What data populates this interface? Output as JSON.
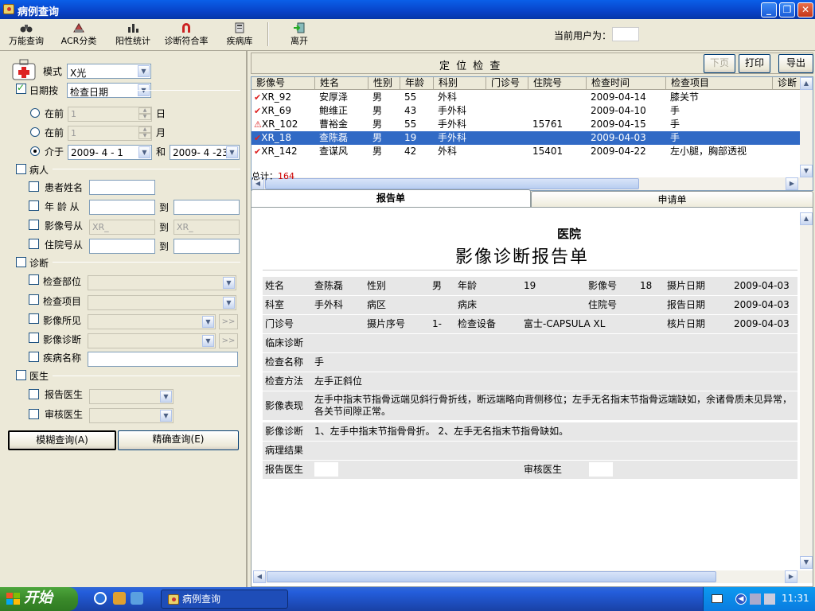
{
  "window": {
    "title": "病例查询"
  },
  "toolbar": {
    "items": [
      {
        "label": "万能查询",
        "icon": "binoculars-icon"
      },
      {
        "label": "ACR分类",
        "icon": "classify-icon"
      },
      {
        "label": "阳性统计",
        "icon": "statistics-icon"
      },
      {
        "label": "诊断符合率",
        "icon": "magnet-icon"
      },
      {
        "label": "疾病库",
        "icon": "disease-library-icon"
      },
      {
        "label": "离开",
        "icon": "exit-icon"
      }
    ],
    "current_user_label": "当前用户为：",
    "current_user_value": ""
  },
  "left": {
    "mode_label": "模式",
    "mode_value": "X光",
    "date_by_label": "日期按",
    "date_by_value": "检查日期",
    "before1_label": "在前",
    "before1_value": "1",
    "before1_unit": "日",
    "before2_label": "在前",
    "before2_value": "1",
    "before2_unit": "月",
    "between_label": "介于",
    "date_from": "2009- 4 - 1",
    "and_label": "和",
    "date_to": "2009- 4 -23",
    "patient_group": "病人",
    "patient_name_label": "患者姓名",
    "age_label": "年 龄 从",
    "to_label": "到",
    "image_no_label": "影像号从",
    "image_prefix": "XR_",
    "inpatient_label": "住院号从",
    "diagnosis_group": "诊断",
    "part_label": "检查部位",
    "item_label": "检查项目",
    "finding_label": "影像所见",
    "diag_label": "影像诊断",
    "disease_label": "疾病名称",
    "doctor_group": "医生",
    "report_doc_label": "报告医生",
    "audit_doc_label": "审核医生",
    "fuzzy_btn": "模糊查询(A)",
    "exact_btn": "精确查询(E)"
  },
  "locate": {
    "title": "定  位  检  查",
    "prev_btn": "下页",
    "print_btn": "打印",
    "export_btn": "导出"
  },
  "grid": {
    "columns": [
      "影像号",
      "姓名",
      "性别",
      "年龄",
      "科别",
      "门诊号",
      "住院号",
      "检查时间",
      "检查项目",
      "诊断"
    ],
    "rows": [
      {
        "status": "check",
        "cells": [
          "XR_92",
          "安厚泽",
          "男",
          "55",
          "外科",
          "",
          "",
          "2009-04-14",
          "膝关节"
        ]
      },
      {
        "status": "check",
        "cells": [
          "XR_69",
          "鲍维正",
          "男",
          "43",
          "手外科",
          "",
          "",
          "2009-04-10",
          "手"
        ]
      },
      {
        "status": "warn",
        "cells": [
          "XR_102",
          "曹裕金",
          "男",
          "55",
          "手外科",
          "",
          "15761",
          "2009-04-15",
          "手"
        ]
      },
      {
        "status": "check",
        "selected": true,
        "cells": [
          "XR_18",
          "查陈磊",
          "男",
          "19",
          "手外科",
          "",
          "",
          "2009-04-03",
          "手"
        ]
      },
      {
        "status": "check",
        "cells": [
          "XR_142",
          "查谋风",
          "男",
          "42",
          "外科",
          "",
          "15401",
          "2009-04-22",
          "左小腿，胸部透视"
        ]
      }
    ],
    "total_label": "总计：",
    "total_value": "164"
  },
  "tabs": [
    "报告单",
    "申请单"
  ],
  "report": {
    "hospital": "医院",
    "title": "影像诊断报告单",
    "name_label": "姓名",
    "name": "查陈磊",
    "sex_label": "性别",
    "sex": "男",
    "age_label": "年龄",
    "age": "19",
    "imgno_label": "影像号",
    "imgno": "18",
    "shoot_date_label": "摄片日期",
    "shoot_date": "2009-04-03",
    "dept_label": "科室",
    "dept": "手外科",
    "ward_label": "病区",
    "ward": "",
    "bed_label": "病床",
    "bed": "",
    "inpatient_label": "住院号",
    "inpatient": "",
    "report_date_label": "报告日期",
    "report_date": "2009-04-03",
    "outpatient_label": "门诊号",
    "outpatient": "",
    "film_seq_label": "摄片序号",
    "film_seq": "1-",
    "device_label": "检查设备",
    "device": "富士-CAPSULA XL",
    "verify_date_label": "核片日期",
    "verify_date": "2009-04-03",
    "clinical_label": "临床诊断",
    "clinical": "",
    "exam_name_label": "检查名称",
    "exam_name": "手",
    "method_label": "检查方法",
    "method": "左手正斜位",
    "findings_label": "影像表现",
    "findings": "左手中指末节指骨远端见斜行骨折线，断远端略向背侧移位；左手无名指末节指骨远端缺如，余诸骨质未见异常，各关节间隙正常。",
    "diagnosis_label": "影像诊断",
    "diagnosis": "1、左手中指末节指骨骨折。 2、左手无名指末节指骨缺如。",
    "pathology_label": "病理结果",
    "pathology": "",
    "report_doc_label": "报告医生",
    "audit_doc_label": "审核医生"
  },
  "taskbar": {
    "start": "开始",
    "task": "病例查询",
    "clock": "11:31"
  }
}
